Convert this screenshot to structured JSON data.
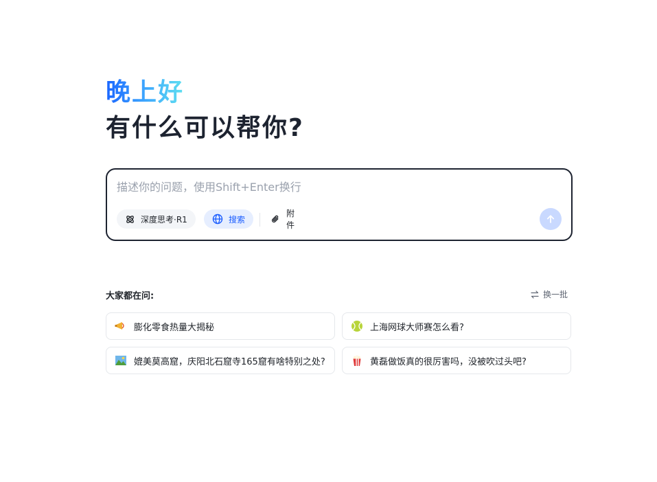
{
  "header": {
    "greeting": "晚上好",
    "subtitle": "有什么可以帮你?"
  },
  "composer": {
    "placeholder": "描述你的问题，使用Shift+Enter换行",
    "value": "",
    "deep_think_label": "深度思考·R1",
    "search_label": "搜索",
    "attach_label": "附件",
    "send_icon": "arrow-up-icon"
  },
  "popular": {
    "title": "大家都在问:",
    "refresh_label": "换一批",
    "questions": [
      {
        "icon": "megaphone-icon",
        "text": "膨化零食热量大揭秘"
      },
      {
        "icon": "tennis-ball-icon",
        "text": "上海网球大师赛怎么看?"
      },
      {
        "icon": "landscape-icon",
        "text": "媲美莫高窟，庆阳北石窟寺165窟有啥特别之处?"
      },
      {
        "icon": "popcorn-icon",
        "text": "黄磊做饭真的很厉害吗，没被吹过头吧?"
      }
    ]
  },
  "colors": {
    "accent": "#1a5cff",
    "search_chip_bg": "#e6eeff",
    "send_disabled": "#c9d9ff",
    "border_dark": "#1d2330"
  }
}
